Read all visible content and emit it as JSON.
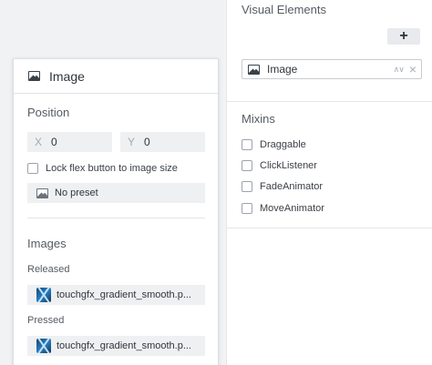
{
  "visual_elements": {
    "title": "Visual Elements",
    "add_label": "+",
    "selected_element": "Image",
    "sort_glyph": "∧∨",
    "clear_glyph": "×"
  },
  "mixins": {
    "title": "Mixins",
    "items": [
      {
        "label": "Draggable",
        "checked": false
      },
      {
        "label": "ClickListener",
        "checked": false
      },
      {
        "label": "FadeAnimator",
        "checked": false
      },
      {
        "label": "MoveAnimator",
        "checked": false
      }
    ]
  },
  "properties": {
    "title": "Image",
    "position": {
      "title": "Position",
      "x_label": "X",
      "x_value": "0",
      "y_label": "Y",
      "y_value": "0",
      "lock_label": "Lock flex button to image size",
      "lock_checked": false,
      "preset_label": "No preset"
    },
    "images": {
      "title": "Images",
      "released_label": "Released",
      "released_file": "touchgfx_gradient_smooth.p...",
      "pressed_label": "Pressed",
      "pressed_file": "touchgfx_gradient_smooth.p..."
    }
  },
  "icons": {
    "image": "image-icon",
    "file": "touchgfx-file-icon"
  }
}
